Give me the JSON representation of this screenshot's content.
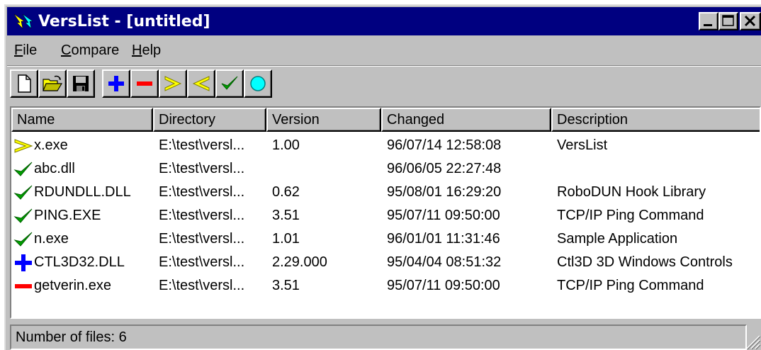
{
  "window": {
    "title": "VersList - [untitled]"
  },
  "menu": {
    "file": {
      "accel": "F",
      "rest": "ile"
    },
    "compare": {
      "accel": "C",
      "rest": "ompare"
    },
    "help": {
      "accel": "H",
      "rest": "elp"
    }
  },
  "toolbar": {
    "buttons": [
      "new-file-icon",
      "open-folder-icon",
      "save-disk-icon",
      "plus-icon",
      "minus-icon",
      "greater-than-icon",
      "less-than-icon",
      "checkmark-icon",
      "circle-icon"
    ]
  },
  "list": {
    "columns": [
      "Name",
      "Directory",
      "Version",
      "Changed",
      "Description"
    ],
    "rows": [
      {
        "icon": "greater-than-icon",
        "name": "x.exe",
        "directory": "E:\\test\\versl...",
        "version": "1.00",
        "changed": "96/07/14 12:58:08",
        "description": "VersList"
      },
      {
        "icon": "checkmark-icon",
        "name": "abc.dll",
        "directory": "E:\\test\\versl...",
        "version": "",
        "changed": "96/06/05 22:27:48",
        "description": ""
      },
      {
        "icon": "checkmark-icon",
        "name": "RDUNDLL.DLL",
        "directory": "E:\\test\\versl...",
        "version": "0.62",
        "changed": "95/08/01 16:29:20",
        "description": "RoboDUN Hook Library"
      },
      {
        "icon": "checkmark-icon",
        "name": "PING.EXE",
        "directory": "E:\\test\\versl...",
        "version": "3.51",
        "changed": "95/07/11 09:50:00",
        "description": "TCP/IP Ping Command"
      },
      {
        "icon": "checkmark-icon",
        "name": "n.exe",
        "directory": "E:\\test\\versl...",
        "version": "1.01",
        "changed": "96/01/01 11:31:46",
        "description": "Sample Application"
      },
      {
        "icon": "plus-icon",
        "name": "CTL3D32.DLL",
        "directory": "E:\\test\\versl...",
        "version": "2.29.000",
        "changed": "95/04/04 08:51:32",
        "description": "Ctl3D 3D Windows Controls"
      },
      {
        "icon": "minus-icon",
        "name": "getverin.exe",
        "directory": "E:\\test\\versl...",
        "version": "3.51",
        "changed": "95/07/11 09:50:00",
        "description": "TCP/IP Ping Command"
      }
    ]
  },
  "status": {
    "text": "Number of files: 6"
  },
  "colors": {
    "titlebar": "#000080",
    "face": "#c0c0c0",
    "plus": "#0000ff",
    "minus": "#ff0000",
    "arrow": "#ffff00",
    "check": "#00a000",
    "circle": "#00ffff"
  }
}
